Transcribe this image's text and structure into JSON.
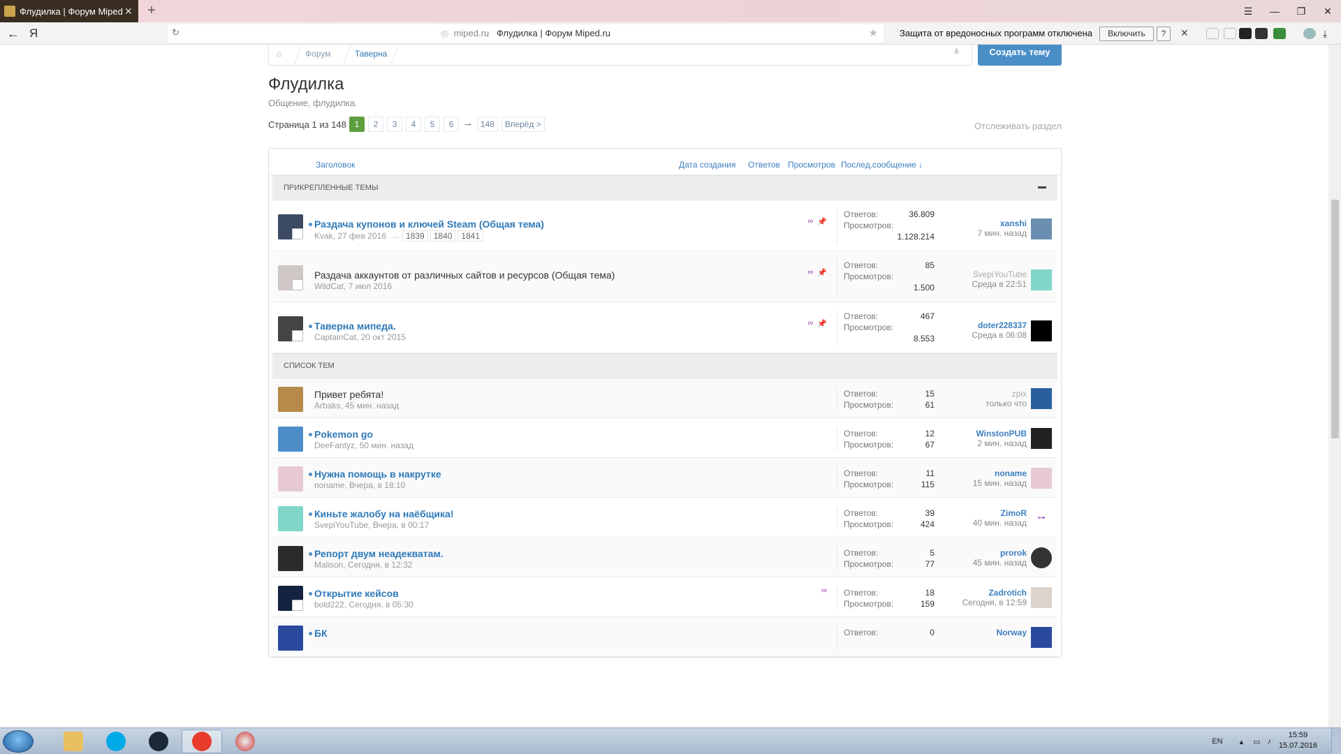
{
  "browser": {
    "tab_title": "Флудилка | Форум Miped",
    "tab_close": "✕",
    "new_tab": "+",
    "yandex_label": "Я",
    "url_host": "miped.ru",
    "url_title": "Флудилка | Форум Miped.ru",
    "protect_text": "Защита от вредоносных программ отключена",
    "enable_btn": "Включить",
    "help_btn": "?",
    "close_bar": "✕"
  },
  "breadcrumb": {
    "forum": "Форум",
    "tavern": "Таверна"
  },
  "create_btn": "Создать тему",
  "forum": {
    "title": "Флудилка",
    "description": "Общение, флудилка.",
    "pager_label": "Страница 1 из 148",
    "pages": [
      "1",
      "2",
      "3",
      "4",
      "5",
      "6"
    ],
    "pager_arrow": "→",
    "last_page": "148",
    "forward": "Вперёд >",
    "watch": "Отслеживать раздел"
  },
  "columns": {
    "title": "Заголовок",
    "created": "Дата создания",
    "replies": "Ответов",
    "views": "Просмотров",
    "last": "Послед.сообщение ↓"
  },
  "sections": {
    "sticky": "Прикрепленные темы",
    "list": "Список тем"
  },
  "stats_labels": {
    "replies": "Ответов:",
    "views": "Просмотров:"
  },
  "sticky_threads": [
    {
      "title": "Раздача купонов и ключей Steam (Общая тема)",
      "author": "Kvak",
      "date": "27 фев 2016",
      "pages": [
        "1839",
        "1840",
        "1841"
      ],
      "ellipsis": "…",
      "replies": "36.809",
      "views": "1.128.214",
      "last_user": "xanshi",
      "last_time": "7 мин. назад",
      "bold": true
    },
    {
      "title": "Раздача аккаунтов от различных сайтов и ресурсов (Общая тема)",
      "author": "WildCat",
      "date": "7 июл 2016",
      "replies": "85",
      "views": "1.500",
      "last_user": "SvepiYouTube",
      "last_time": "Среда в 22:51",
      "bold": false
    },
    {
      "title": "Таверна мипеда.",
      "author": "CaptainCat",
      "date": "20 окт 2015",
      "replies": "467",
      "views": "8.553",
      "last_user": "doter228337",
      "last_time": "Среда в 06:08",
      "bold": true
    }
  ],
  "threads": [
    {
      "title": "Привет ребята!",
      "author": "Arbaks",
      "date": "45 мин. назад",
      "replies": "15",
      "views": "61",
      "last_user": "zpix",
      "last_time": "только что",
      "bold": false
    },
    {
      "title": "Pokemon go",
      "author": "DeeFantyz",
      "date": "50 мин. назад",
      "replies": "12",
      "views": "67",
      "last_user": "WinstonPUB",
      "last_time": "2 мин. назад",
      "bold": true
    },
    {
      "title": "Нужна помощь в накрутке",
      "author": "noname",
      "date": "Вчера, в 18:10",
      "replies": "11",
      "views": "115",
      "last_user": "noname",
      "last_time": "15 мин. назад",
      "bold": true
    },
    {
      "title": "Киньте жалобу на наёбщика!",
      "author": "SvepiYouTube",
      "date": "Вчера, в 00:17",
      "replies": "39",
      "views": "424",
      "last_user": "ZimoR",
      "last_time": "40 мин. назад",
      "bold": true
    },
    {
      "title": "Репорт двум неадекватам.",
      "author": "Malison",
      "date": "Сегодня, в 12:32",
      "replies": "5",
      "views": "77",
      "last_user": "prorok",
      "last_time": "45 мин. назад",
      "bold": true
    },
    {
      "title": "Открытие кейсов",
      "author": "bold222",
      "date": "Сегодня, в 05:30",
      "replies": "18",
      "views": "159",
      "last_user": "Zadrotich",
      "last_time": "Сегодня, в 12:59",
      "bold": true
    },
    {
      "title": "БК",
      "author": "",
      "date": "",
      "replies": "0",
      "views": "",
      "last_user": "Norway",
      "last_time": "",
      "bold": true
    }
  ],
  "taskbar": {
    "lang": "EN",
    "time": "15:59",
    "date": "15.07.2016"
  },
  "colors": {
    "accent": "#2e79b8",
    "create_btn": "#4a8ec8",
    "current_page": "#5e9f3f"
  }
}
